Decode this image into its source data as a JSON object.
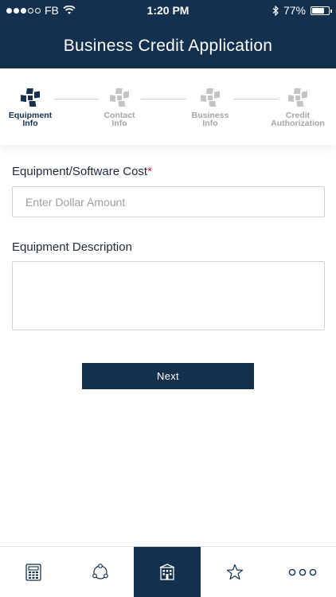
{
  "status_bar": {
    "carrier": "FB",
    "time": "1:20 PM",
    "battery": "77%",
    "battery_level": 0.77
  },
  "header": {
    "title": "Business Credit Application"
  },
  "stepper": {
    "steps": [
      {
        "line1": "Equipment",
        "line2": "Info",
        "active": true
      },
      {
        "line1": "Contact",
        "line2": "Info",
        "active": false
      },
      {
        "line1": "Business",
        "line2": "Info",
        "active": false
      },
      {
        "line1": "Credit",
        "line2": "Authorization",
        "active": false
      }
    ]
  },
  "form": {
    "cost_label": "Equipment/Software Cost",
    "required_mark": "*",
    "cost_placeholder": "Enter Dollar Amount",
    "description_label": "Equipment Description",
    "next_label": "Next"
  },
  "tabbar": {
    "items": [
      {
        "icon": "calculator-icon",
        "active": false
      },
      {
        "icon": "share-network-icon",
        "active": false
      },
      {
        "icon": "building-icon",
        "active": true
      },
      {
        "icon": "star-icon",
        "active": false
      },
      {
        "icon": "more-dots-icon",
        "active": false
      }
    ]
  },
  "colors": {
    "primary": "#14304f",
    "required": "#cc1f2f",
    "inactive": "#a6a6a6"
  }
}
